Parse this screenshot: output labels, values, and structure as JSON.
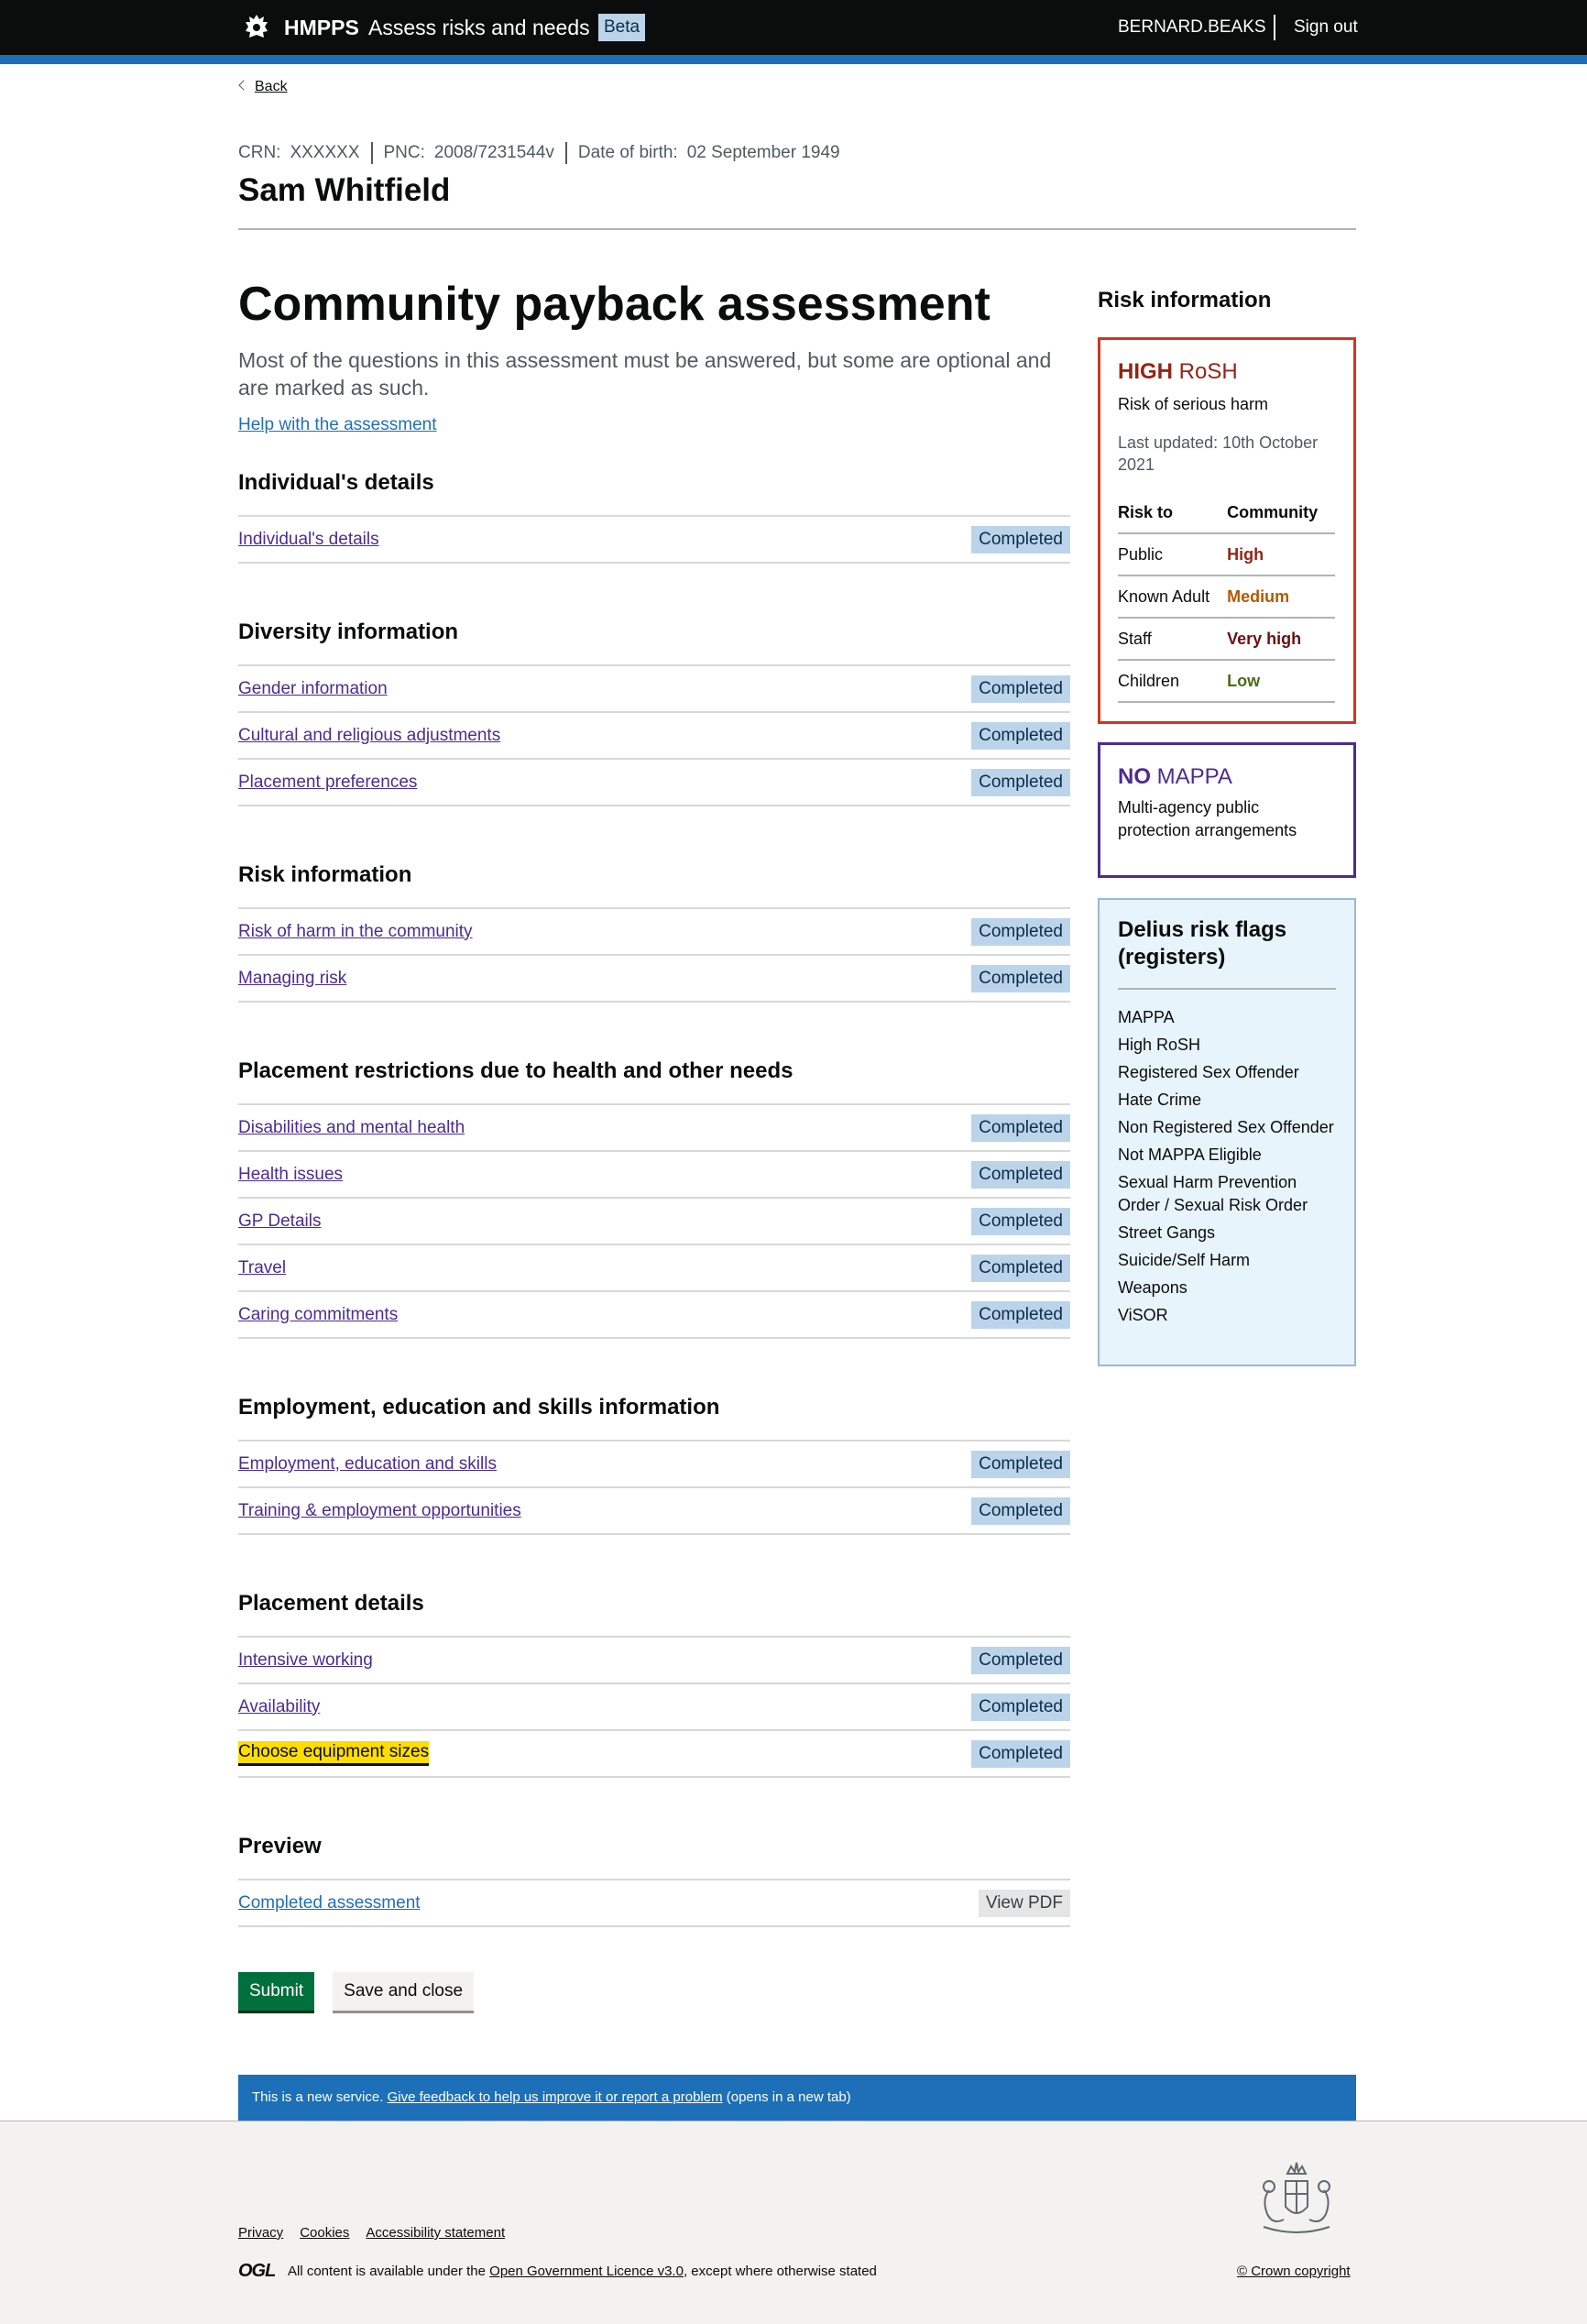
{
  "header": {
    "brand": "HMPPS",
    "service": "Assess risks and needs",
    "phase_tag": "Beta",
    "user": "BERNARD.BEAKS",
    "sign_out": "Sign out"
  },
  "back_link": "Back",
  "person": {
    "crn_label": "CRN:",
    "crn": "XXXXXX",
    "pnc_label": "PNC:",
    "pnc": "2008/7231544v",
    "dob_label": "Date of birth:",
    "dob": "02 September 1949",
    "name": "Sam Whitfield"
  },
  "main": {
    "title": "Community payback assessment",
    "lead": "Most of the questions in this assessment must be answered, but some are optional and are marked as such.",
    "help_link": "Help with the assessment",
    "sections": [
      {
        "heading": "Individual's details",
        "items": [
          {
            "label": "Individual's details",
            "status": "Completed"
          }
        ]
      },
      {
        "heading": "Diversity information",
        "items": [
          {
            "label": "Gender information",
            "status": "Completed"
          },
          {
            "label": "Cultural and religious adjustments",
            "status": "Completed"
          },
          {
            "label": "Placement preferences",
            "status": "Completed"
          }
        ]
      },
      {
        "heading": "Risk information",
        "items": [
          {
            "label": "Risk of harm in the community",
            "status": "Completed"
          },
          {
            "label": "Managing risk",
            "status": "Completed"
          }
        ]
      },
      {
        "heading": "Placement restrictions due to health and other needs",
        "items": [
          {
            "label": "Disabilities and mental health",
            "status": "Completed"
          },
          {
            "label": "Health issues",
            "status": "Completed"
          },
          {
            "label": "GP Details",
            "status": "Completed"
          },
          {
            "label": "Travel",
            "status": "Completed"
          },
          {
            "label": "Caring commitments",
            "status": "Completed"
          }
        ]
      },
      {
        "heading": "Employment, education and skills information",
        "items": [
          {
            "label": "Employment, education and skills",
            "status": "Completed"
          },
          {
            "label": "Training & employment opportunities",
            "status": "Completed"
          }
        ]
      },
      {
        "heading": "Placement details",
        "items": [
          {
            "label": "Intensive working",
            "status": "Completed"
          },
          {
            "label": "Availability",
            "status": "Completed"
          },
          {
            "label": "Choose equipment sizes",
            "status": "Completed"
          }
        ]
      },
      {
        "heading": "Preview",
        "items": [
          {
            "label": "Completed assessment",
            "status": "View PDF"
          }
        ]
      }
    ],
    "submit": "Submit",
    "save_close": "Save and close"
  },
  "sidebar": {
    "heading": "Risk information",
    "rosh": {
      "level": "HIGH",
      "label": "RoSH",
      "subtitle": "Risk of serious harm",
      "updated": "Last updated: 10th October 2021",
      "col_risk_to": "Risk to",
      "col_community": "Community",
      "rows": [
        {
          "who": "Public",
          "level": "High",
          "color": "#942514"
        },
        {
          "who": "Known Adult",
          "level": "Medium",
          "color": "#b35a00"
        },
        {
          "who": "Staff",
          "level": "Very high",
          "color": "#6b1010"
        },
        {
          "who": "Children",
          "level": "Low",
          "color": "#4a6b1a"
        }
      ]
    },
    "mappa": {
      "prefix": "NO",
      "label": "MAPPA",
      "subtitle": "Multi-agency public protection arrangements"
    },
    "flags": {
      "heading": "Delius risk flags (registers)",
      "items": [
        "MAPPA",
        "High RoSH",
        "Registered Sex Offender",
        "Hate Crime",
        "Non Registered Sex Offender",
        "Not MAPPA Eligible",
        "Sexual Harm Prevention Order / Sexual Risk Order",
        "Street Gangs",
        "Suicide/Self Harm",
        "Weapons",
        "ViSOR"
      ]
    }
  },
  "phase_banner": {
    "text_before": "This is a new service.",
    "link": "Give feedback to help us improve it or report a problem",
    "text_after": "(opens in a new tab)"
  },
  "footer": {
    "links": [
      "Privacy",
      "Cookies",
      "Accessibility statement"
    ],
    "ogl": "OGL",
    "licence_before": "All content is available under the",
    "licence_link": "Open Government Licence v3.0",
    "licence_after": ", except where otherwise stated",
    "copyright": "© Crown copyright"
  }
}
